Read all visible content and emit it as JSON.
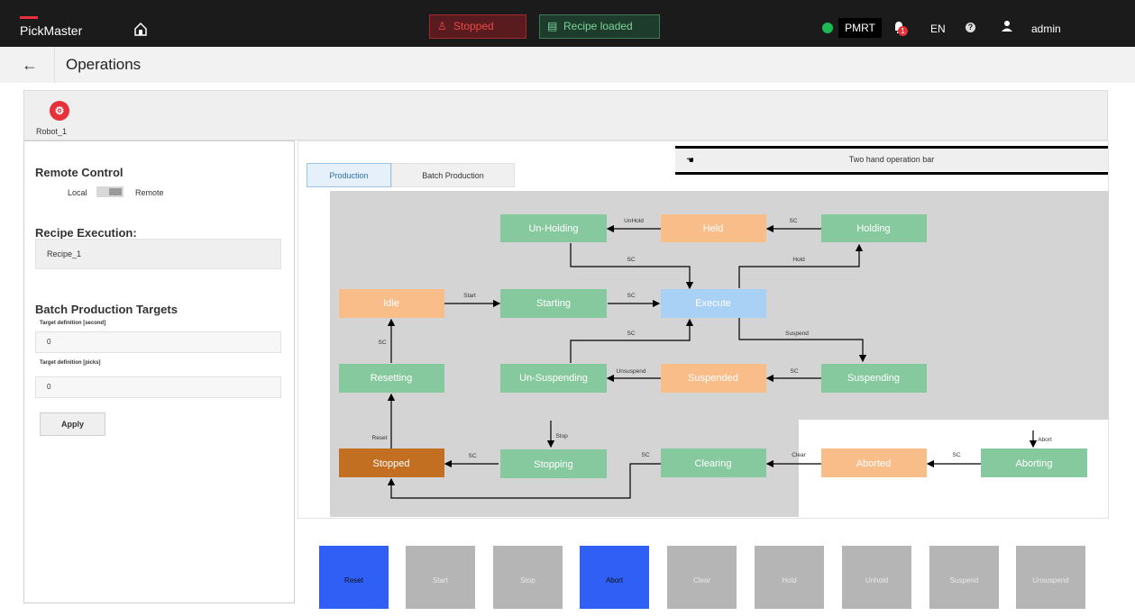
{
  "topbar": {
    "brand": "PickMaster",
    "status_stopped": "Stopped",
    "status_recipe": "Recipe loaded",
    "controller": "PMRT",
    "notification_count": "1",
    "language": "EN",
    "help": "?",
    "user": "admin"
  },
  "titlebar": {
    "back": "←",
    "title": "Operations"
  },
  "robot": {
    "name": "Robot_1"
  },
  "left": {
    "remote_control_title": "Remote Control",
    "local_label": "Local",
    "remote_label": "Remote",
    "recipe_title": "Recipe Execution:",
    "recipe_value": "Recipe_1",
    "batch_title": "Batch Production Targets",
    "target_second_label": "Target definition [second]",
    "target_second_value": "0",
    "target_picks_label": "Target definition [picks]",
    "target_picks_value": "0",
    "apply_label": "Apply"
  },
  "main": {
    "tabs": [
      "Production",
      "Batch Production"
    ],
    "two_hand_bar": "Two hand operation bar"
  },
  "states": {
    "un_holding": "Un-Holding",
    "held": "Held",
    "holding": "Holding",
    "idle": "Idle",
    "starting": "Starting",
    "execute": "Execute",
    "resetting": "Resetting",
    "un_suspending": "Un-Suspending",
    "suspended": "Suspended",
    "suspending": "Suspending",
    "stopped": "Stopped",
    "stopping": "Stopping",
    "clearing": "Clearing",
    "aborted": "Aborted",
    "aborting": "Aborting"
  },
  "transitions": {
    "unhold": "UnHold",
    "sc": "SC",
    "hold": "Hold",
    "start": "Start",
    "suspend": "Suspend",
    "unsuspend": "Unsuspend",
    "reset": "Reset",
    "stop": "Stop",
    "clear": "Clear",
    "abort": "Abort"
  },
  "buttons": [
    {
      "label": "Reset",
      "enabled": true
    },
    {
      "label": "Start",
      "enabled": false
    },
    {
      "label": "Stop",
      "enabled": false
    },
    {
      "label": "Abort",
      "enabled": true
    },
    {
      "label": "Clear",
      "enabled": false
    },
    {
      "label": "Hold",
      "enabled": false
    },
    {
      "label": "Unhold",
      "enabled": false
    },
    {
      "label": "Suspend",
      "enabled": false
    },
    {
      "label": "Unsuspend",
      "enabled": false
    }
  ],
  "colors": {
    "green_state": "#86c99e",
    "orange_state": "#f9bd8a",
    "active_state": "#a9d0f5",
    "stopped_state": "#c26f22",
    "diagram_bg": "#d4d4d4",
    "button_enabled": "#2f5ff5",
    "button_disabled": "#b5b5b5"
  }
}
